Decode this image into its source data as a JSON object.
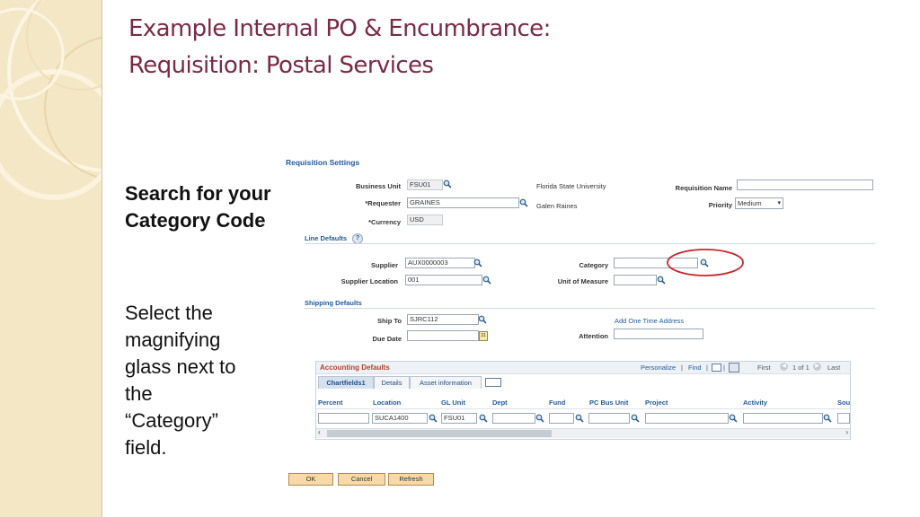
{
  "slide": {
    "title_line1": "Example Internal PO & Encumbrance:",
    "title_line2": "Requisition: Postal Services",
    "callout_bold": "Search for your Category Code",
    "instruction_lines": [
      "Select the",
      "magnifying",
      "glass next to",
      "the",
      "“Category”",
      "field."
    ]
  },
  "form": {
    "requisition_settings": "Requisition Settings",
    "business_unit_label": "Business Unit",
    "business_unit_value": "FSU01",
    "business_unit_desc": "Florida State University",
    "requester_label": "*Requester",
    "requester_value": "GRAINES",
    "requester_desc": "Galen Raines",
    "currency_label": "*Currency",
    "currency_value": "USD",
    "requisition_name_label": "Requisition Name",
    "requisition_name_value": "",
    "priority_label": "Priority",
    "priority_value": "Medium",
    "line_defaults": "Line Defaults",
    "supplier_label": "Supplier",
    "supplier_value": "AUX0000003",
    "supplier_location_label": "Supplier Location",
    "supplier_location_value": "001",
    "category_label": "Category",
    "category_value": "",
    "uom_label": "Unit of Measure",
    "uom_value": "",
    "shipping_defaults": "Shipping Defaults",
    "ship_to_label": "Ship To",
    "ship_to_value": "SJRC112",
    "due_date_label": "Due Date",
    "due_date_value": "",
    "add_one_time_address": "Add One Time Address",
    "attention_label": "Attention",
    "attention_value": ""
  },
  "accounting": {
    "title": "Accounting Defaults",
    "personalize": "Personalize",
    "find": "Find",
    "first": "First",
    "count": "1 of 1",
    "last": "Last",
    "tabs": [
      "Chartfields1",
      "Details",
      "Asset information"
    ],
    "columns": [
      "Percent",
      "Location",
      "GL Unit",
      "Dept",
      "Fund",
      "PC Bus Unit",
      "Project",
      "Activity",
      "Sou"
    ],
    "row": {
      "percent": "",
      "location": "SUCA1400",
      "gl_unit": "FSU01",
      "dept": "",
      "fund": "",
      "pc_bus_unit": "",
      "project": "",
      "activity": ""
    }
  },
  "buttons": {
    "ok": "OK",
    "cancel": "Cancel",
    "refresh": "Refresh"
  },
  "colors": {
    "title": "#7b2a45",
    "link": "#1f5a9e",
    "highlight_circle": "#c8262b",
    "sidebar": "#f4e7c6"
  }
}
